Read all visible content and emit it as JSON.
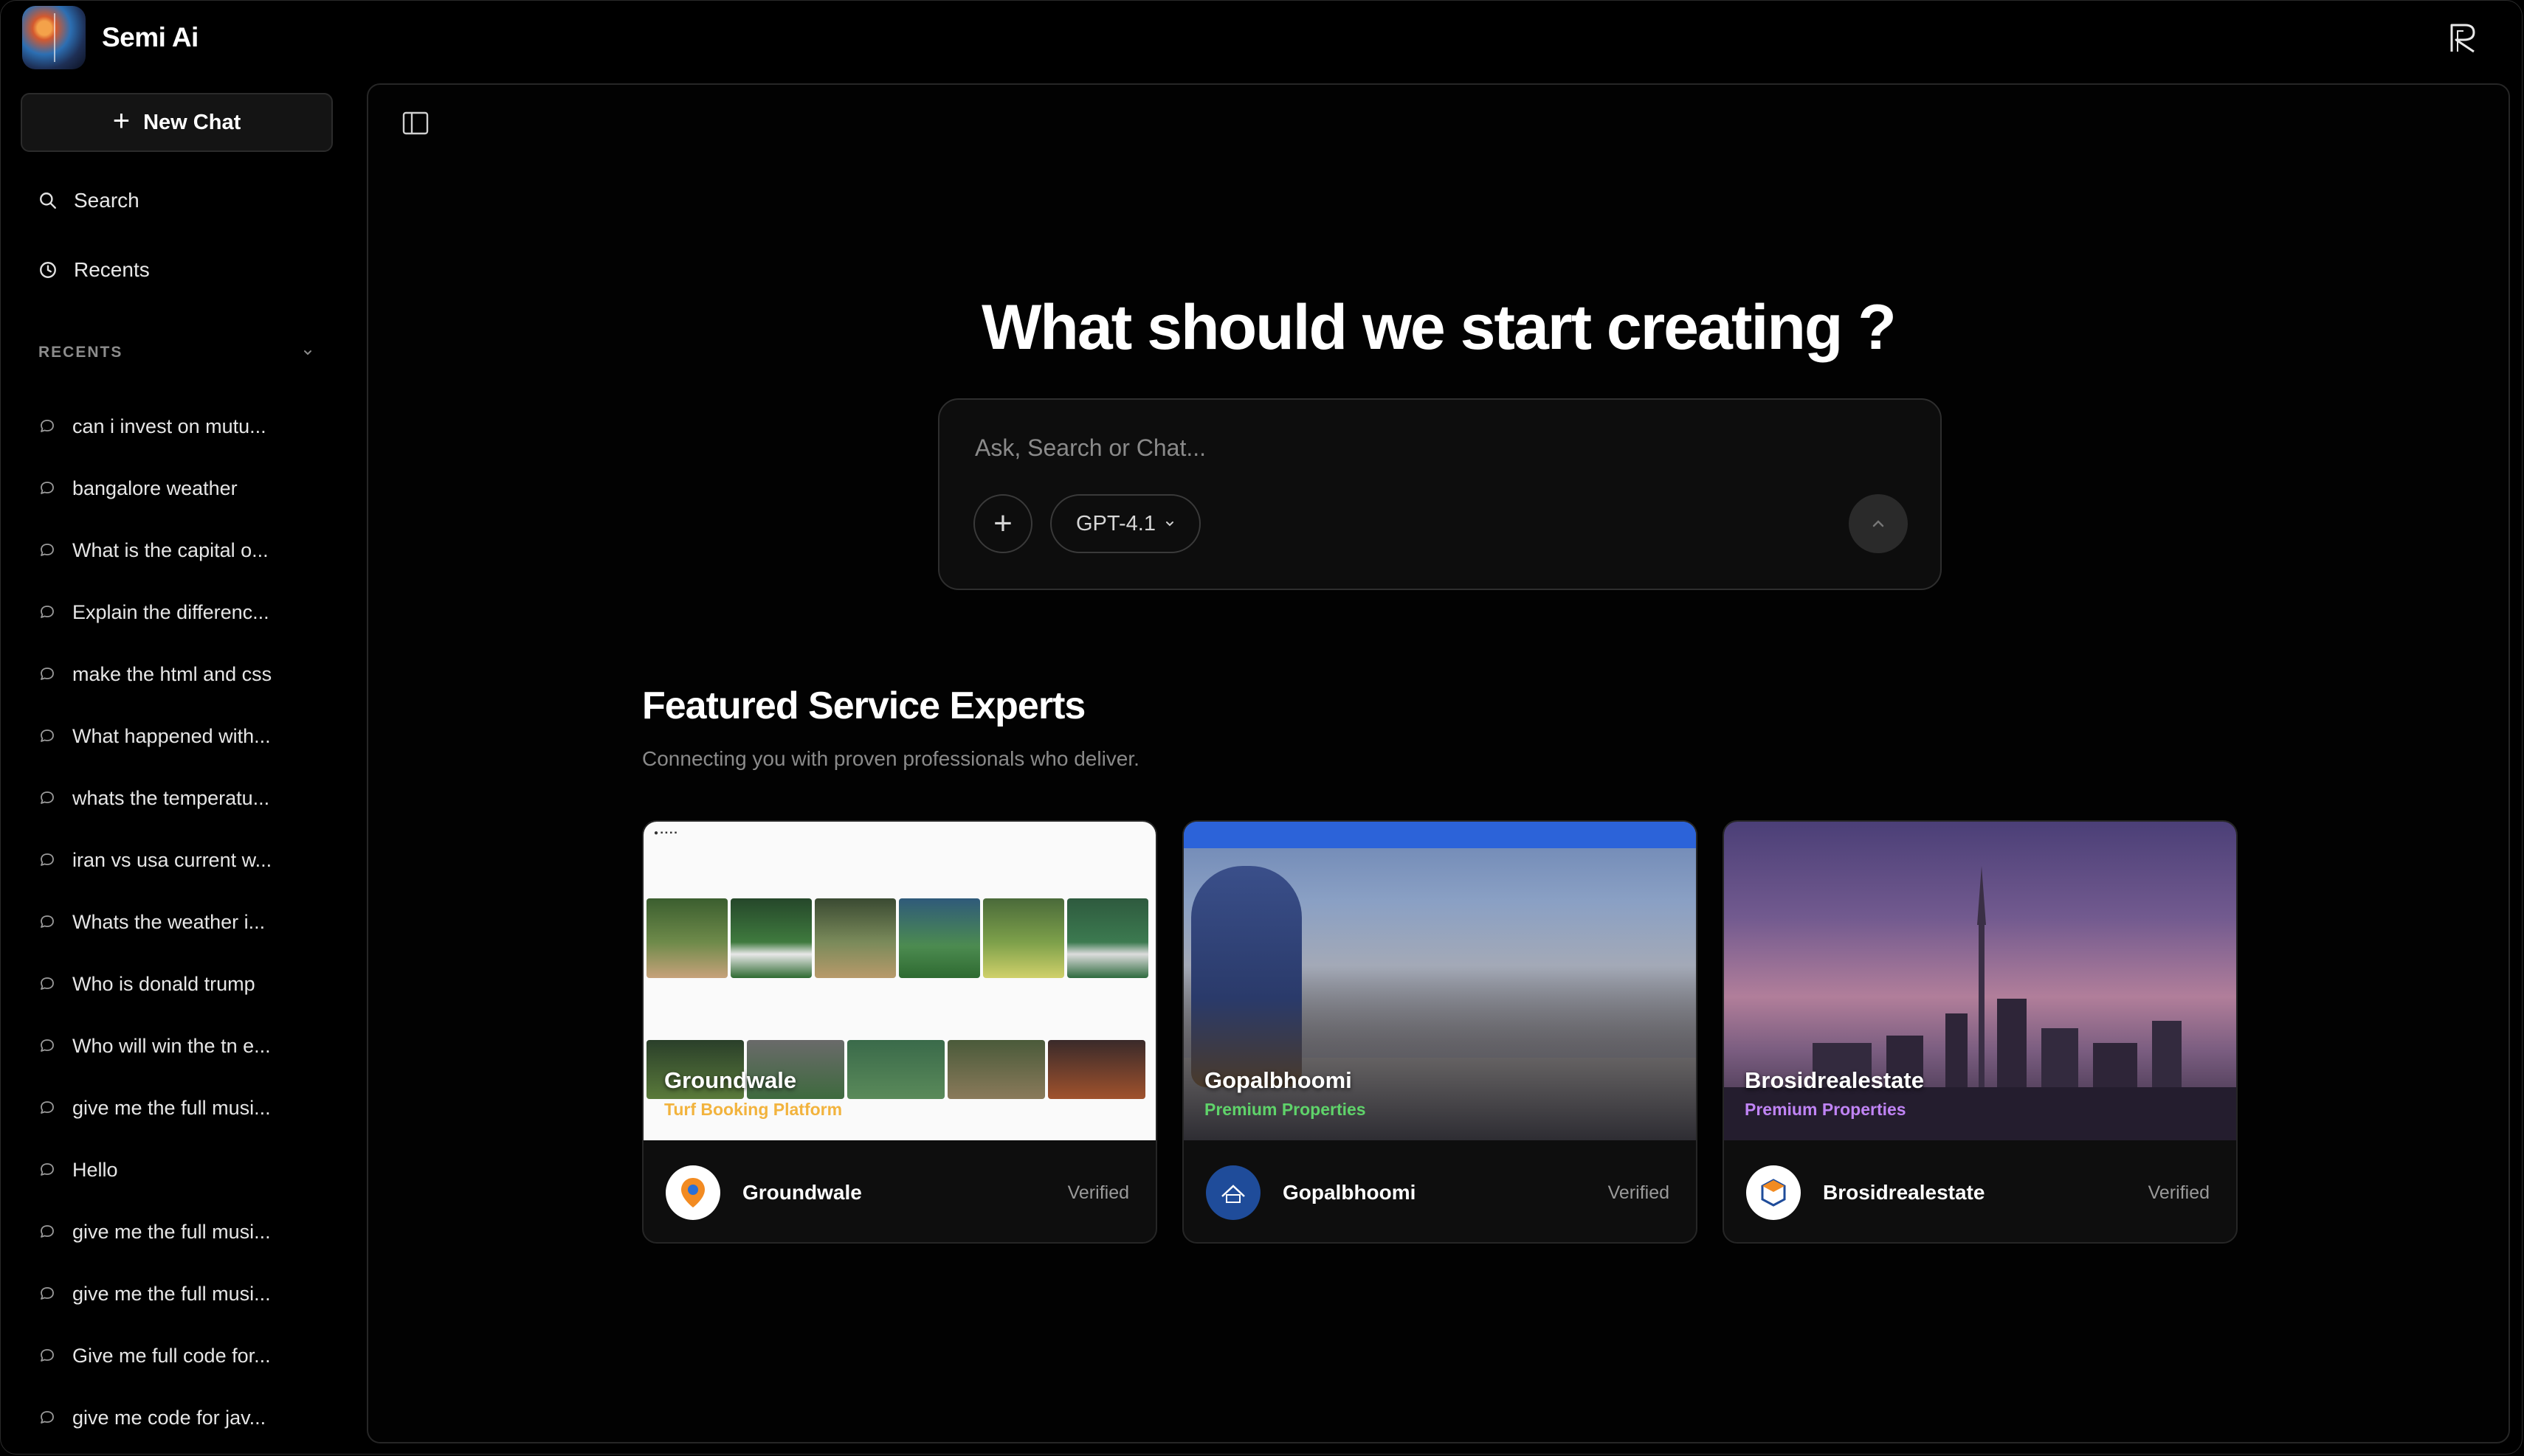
{
  "app": {
    "name": "Semi Ai"
  },
  "sidebar": {
    "new_chat_label": "New Chat",
    "search_label": "Search",
    "recents_label": "Recents",
    "recents_header": "RECENTS",
    "recent_items": [
      "can i invest on mutu...",
      "bangalore weather",
      "What is the capital o...",
      "Explain the differenc...",
      "make the html and css",
      "What happened with...",
      "whats the temperatu...",
      "iran vs usa current w...",
      "Whats the weather i...",
      "Who is donald trump",
      "Who will win the tn e...",
      "give me the full musi...",
      "Hello",
      "give me the full musi...",
      "give me the full musi...",
      "Give me full code for...",
      "give me code for jav..."
    ]
  },
  "main": {
    "title": "What should we start creating ?",
    "composer": {
      "placeholder": "Ask, Search or Chat...",
      "model_label": "GPT-4.1"
    },
    "featured": {
      "title": "Featured Service Experts",
      "subtitle": "Connecting you with proven professionals who deliver.",
      "cards": [
        {
          "title": "Groundwale",
          "tag": "Turf Booking Platform",
          "tag_color": "#f2b33d",
          "name": "Groundwale",
          "status": "Verified"
        },
        {
          "title": "Gopalbhoomi",
          "tag": "Premium Properties",
          "tag_color": "#5fd36a",
          "name": "Gopalbhoomi",
          "status": "Verified"
        },
        {
          "title": "Brosidrealestate",
          "tag": "Premium Properties",
          "tag_color": "#c084f5",
          "name": "Brosidrealestate",
          "status": "Verified"
        }
      ]
    }
  }
}
